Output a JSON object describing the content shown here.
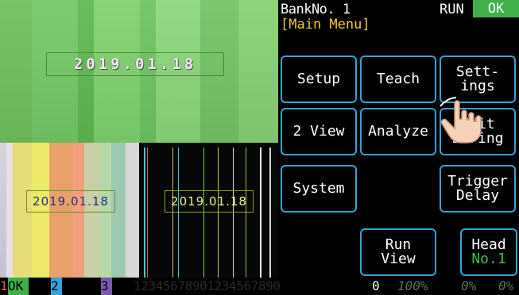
{
  "cameras": {
    "main_timestamp": "2019.01.18",
    "color_timestamp": "2019.01.18",
    "mono_timestamp": "2019.01.18"
  },
  "header": {
    "bank": "BankNo. 1",
    "run_status": "RUN",
    "result": "OK",
    "menu_title": "[Main Menu]"
  },
  "menu": {
    "setup": "Setup",
    "teach": "Teach",
    "settings": "Sett-\nings",
    "two_view": "2 View",
    "analyze": "Analyze",
    "edit_string": "Edit\nString",
    "system": "System",
    "trigger_delay": "Trigger\nDelay",
    "run_view": "Run\nView",
    "head": "Head",
    "head_number": "No.1"
  },
  "status_bar": {
    "cam1": "1",
    "cam1_result": "OK",
    "cam2": "2",
    "cam3": "3",
    "digits": "12345678901234567890",
    "count": "0",
    "rate1": "100%",
    "rate2": "0%",
    "rate3": "0%"
  },
  "colors": {
    "accent_border": "#33a2d8",
    "ok_green": "#3fb04a",
    "menu_title_yellow": "#f2c83b"
  }
}
